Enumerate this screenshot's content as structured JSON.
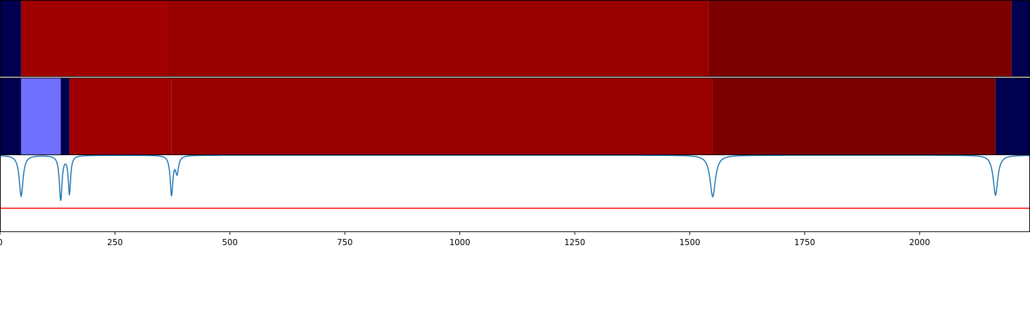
{
  "chart_data": {
    "type": "heatmap",
    "xlim": [
      0,
      2240
    ],
    "x_ticks": [
      "0",
      "250",
      "500",
      "750",
      "1000",
      "1250",
      "1500",
      "1750",
      "2000"
    ],
    "tick_values": [
      0,
      250,
      500,
      750,
      1000,
      1250,
      1500,
      1750,
      2000
    ],
    "grid": false,
    "legend": "none",
    "colors": {
      "dark_navy": "#000050",
      "light_blue": "#7070ff",
      "red": "#a00000",
      "mid_red": "#980000",
      "dark_red": "#7c0000",
      "line": "#1f77b4",
      "threshold": "#ff0000"
    },
    "track_top": {
      "segments": [
        {
          "start": 0,
          "end": 46,
          "color": "#000050"
        },
        {
          "start": 46,
          "end": 362,
          "color": "#a00000"
        },
        {
          "start": 362,
          "end": 1540,
          "color": "#980000"
        },
        {
          "start": 1540,
          "end": 2200,
          "color": "#7c0000"
        },
        {
          "start": 2200,
          "end": 2240,
          "color": "#000050"
        }
      ]
    },
    "track_middle": {
      "segments": [
        {
          "start": 0,
          "end": 46,
          "color": "#000050"
        },
        {
          "start": 46,
          "end": 132,
          "color": "#7070ff"
        },
        {
          "start": 132,
          "end": 151,
          "color": "#000050"
        },
        {
          "start": 151,
          "end": 373,
          "color": "#a00000"
        },
        {
          "start": 373,
          "end": 1550,
          "color": "#980000"
        },
        {
          "start": 1550,
          "end": 2165,
          "color": "#7c0000"
        },
        {
          "start": 2165,
          "end": 2240,
          "color": "#000050"
        }
      ]
    },
    "signal": {
      "ylim": [
        0,
        1
      ],
      "baseline": 1.0,
      "threshold": 0.31,
      "dips": [
        {
          "x": 46,
          "depth": 0.53,
          "width": 5
        },
        {
          "x": 132,
          "depth": 0.58,
          "width": 3.5
        },
        {
          "x": 151,
          "depth": 0.5,
          "width": 3
        },
        {
          "x": 373,
          "depth": 0.51,
          "width": 3.5
        },
        {
          "x": 385,
          "depth": 0.22,
          "width": 4
        },
        {
          "x": 1550,
          "depth": 0.54,
          "width": 7
        },
        {
          "x": 2165,
          "depth": 0.52,
          "width": 6
        }
      ]
    }
  }
}
